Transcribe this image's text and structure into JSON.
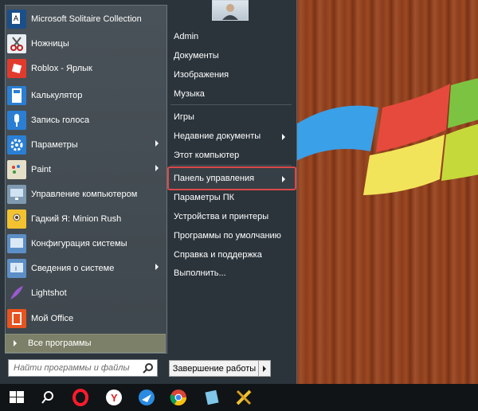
{
  "start_menu": {
    "programs": [
      {
        "label": "Microsoft Solitaire Collection",
        "icon": "cards-icon",
        "has_submenu": false,
        "color": "#1b4f8a"
      },
      {
        "label": "Ножницы",
        "icon": "scissors-icon",
        "has_submenu": false,
        "color": "#e9eef2"
      },
      {
        "label": "Roblox - Ярлык",
        "icon": "roblox-icon",
        "has_submenu": false,
        "color": "#e23b2e"
      },
      {
        "label": "Калькулятор",
        "icon": "calculator-icon",
        "has_submenu": false,
        "color": "#2a7fd4"
      },
      {
        "label": "Запись голоса",
        "icon": "microphone-icon",
        "has_submenu": false,
        "color": "#2a7fd4"
      },
      {
        "label": "Параметры",
        "icon": "gear-icon",
        "has_submenu": true,
        "color": "#2a7fd4"
      },
      {
        "label": "Paint",
        "icon": "palette-icon",
        "has_submenu": true,
        "color": "#e7e0c9"
      },
      {
        "label": "Управление компьютером",
        "icon": "computer-management-icon",
        "has_submenu": false,
        "color": "#7f9ab0"
      },
      {
        "label": "Гадкий Я: Minion Rush",
        "icon": "minion-icon",
        "has_submenu": false,
        "color": "#f2c230"
      },
      {
        "label": "Конфигурация системы",
        "icon": "system-config-icon",
        "has_submenu": false,
        "color": "#5d8fc7"
      },
      {
        "label": "Сведения о системе",
        "icon": "system-info-icon",
        "has_submenu": true,
        "color": "#5d8fc7"
      },
      {
        "label": "Lightshot",
        "icon": "feather-icon",
        "has_submenu": false,
        "color": "#9b59d0"
      },
      {
        "label": "Мой Office",
        "icon": "office-icon",
        "has_submenu": false,
        "color": "#e8531f"
      }
    ],
    "all_programs": "Все программы",
    "search": {
      "placeholder": "Найти программы и файлы"
    },
    "right_items": [
      {
        "label": "Admin",
        "has_submenu": false
      },
      {
        "label": "Документы",
        "has_submenu": false
      },
      {
        "label": "Изображения",
        "has_submenu": false
      },
      {
        "label": "Музыка",
        "has_submenu": false
      },
      {
        "label": "Игры",
        "has_submenu": false
      },
      {
        "label": "Недавние документы",
        "has_submenu": true
      },
      {
        "label": "Этот компьютер",
        "has_submenu": false
      },
      {
        "label": "Панель управления",
        "has_submenu": true,
        "highlighted": true
      },
      {
        "label": "Параметры ПК",
        "has_submenu": false
      },
      {
        "label": "Устройства и принтеры",
        "has_submenu": false
      },
      {
        "label": "Программы по умолчанию",
        "has_submenu": false
      },
      {
        "label": "Справка и поддержка",
        "has_submenu": false
      },
      {
        "label": "Выполнить...",
        "has_submenu": false
      }
    ],
    "shutdown_label": "Завершение работы",
    "highlight_color": "#d94a4a"
  },
  "taskbar": {
    "icons": [
      "windows-start-icon",
      "search-icon",
      "opera-icon",
      "yandex-browser-icon",
      "airplane-app-icon",
      "chrome-icon",
      "notes-app-icon",
      "tools-app-icon"
    ]
  }
}
